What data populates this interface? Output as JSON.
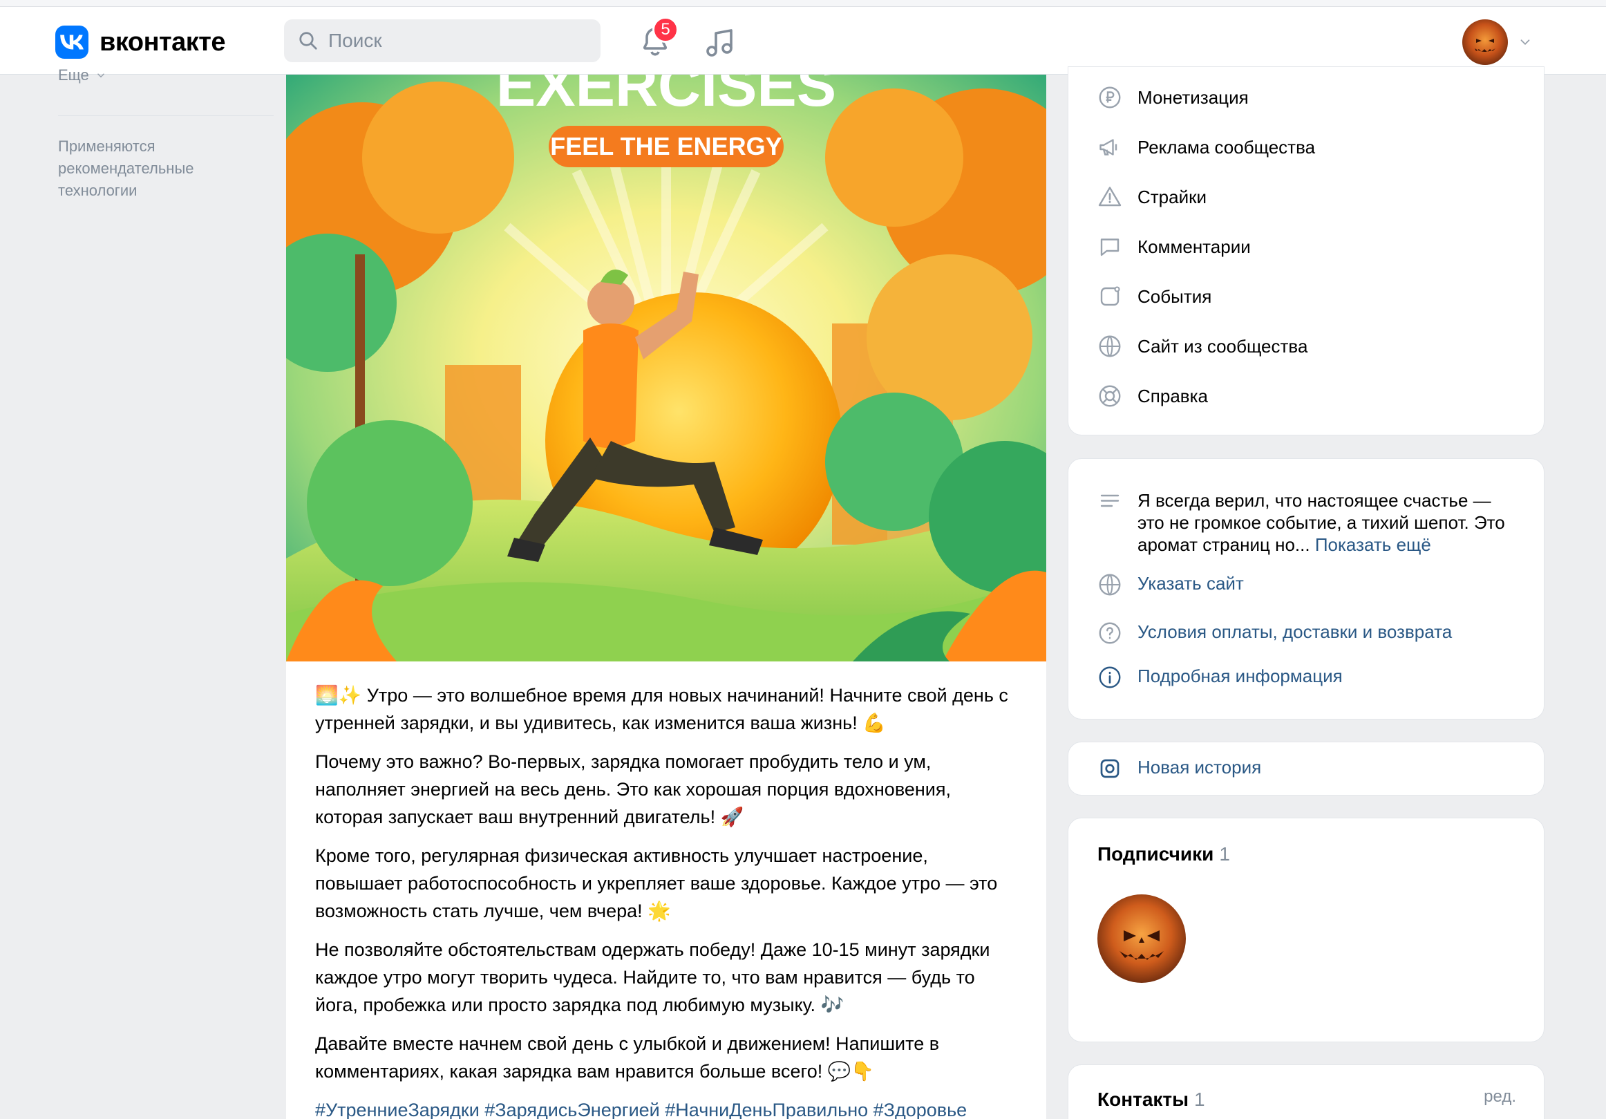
{
  "header": {
    "logo_text": "вконтакте",
    "search_placeholder": "Поиск",
    "notifications_count": "5"
  },
  "left": {
    "more_label": "Еще",
    "note": "Применяются рекомендательные технологии"
  },
  "post": {
    "image_title": "EXERCISES",
    "image_subtitle": "FEEL THE ENERGY",
    "p1_emoji": "🌅✨",
    "p1": "Утро — это волшебное время для новых начинаний! Начните свой день с утренней зарядки, и вы удивитесь, как изменится ваша жизнь!",
    "p1_end": "💪",
    "p2": "Почему это важно? Во-первых, зарядка помогает пробудить тело и ум, наполняет энергией на весь день. Это как хорошая порция вдохновения, которая запускает ваш внутренний двигатель!",
    "p2_end": "🚀",
    "p3": "Кроме того, регулярная физическая активность улучшает настроение, повышает работоспособность и укрепляет ваше здоровье. Каждое утро — это возможность стать лучше, чем вчера!",
    "p3_end": "🌟",
    "p4": "Не позволяйте обстоятельствам одержать победу! Даже 10-15 минут зарядки каждое утро могут творить чудеса. Найдите то, что вам нравится — будь то йога, пробежка или просто зарядка под любимую музыку.",
    "p4_end": "🎶",
    "p5": "Давайте вместе начнем свой день с улыбкой и движением! Напишите в комментариях, какая зарядка вам нравится больше всего!",
    "p5_end": "💬👇",
    "hashtags": "#УтренниеЗарядки #ЗарядисьЭнергией #НачниДеньПравильно #Здоровье"
  },
  "menu": {
    "items": [
      {
        "label": "Монетизация",
        "icon": "ruble-icon"
      },
      {
        "label": "Реклама сообщества",
        "icon": "megaphone-icon"
      },
      {
        "label": "Страйки",
        "icon": "warning-icon"
      },
      {
        "label": "Комментарии",
        "icon": "comment-icon"
      },
      {
        "label": "События",
        "icon": "event-icon"
      },
      {
        "label": "Сайт из сообщества",
        "icon": "globe-icon"
      },
      {
        "label": "Справка",
        "icon": "lifebuoy-icon"
      }
    ]
  },
  "about": {
    "description": "Я всегда верил, что настоящее счастье — это не громкое событие, а тихий шепот. Это аромат страниц но...",
    "show_more": "Показать ещё",
    "website": "Указать сайт",
    "terms": "Условия оплаты, доставки и возврата",
    "details": "Подробная информация"
  },
  "story": {
    "label": "Новая история"
  },
  "subscribers": {
    "title": "Подписчики",
    "count": "1"
  },
  "contacts": {
    "title": "Контакты",
    "count": "1",
    "edit": "ред."
  },
  "colors": {
    "accent": "#0077ff",
    "link": "#2a5885",
    "badge": "#ff3347",
    "muted": "#818c99"
  }
}
